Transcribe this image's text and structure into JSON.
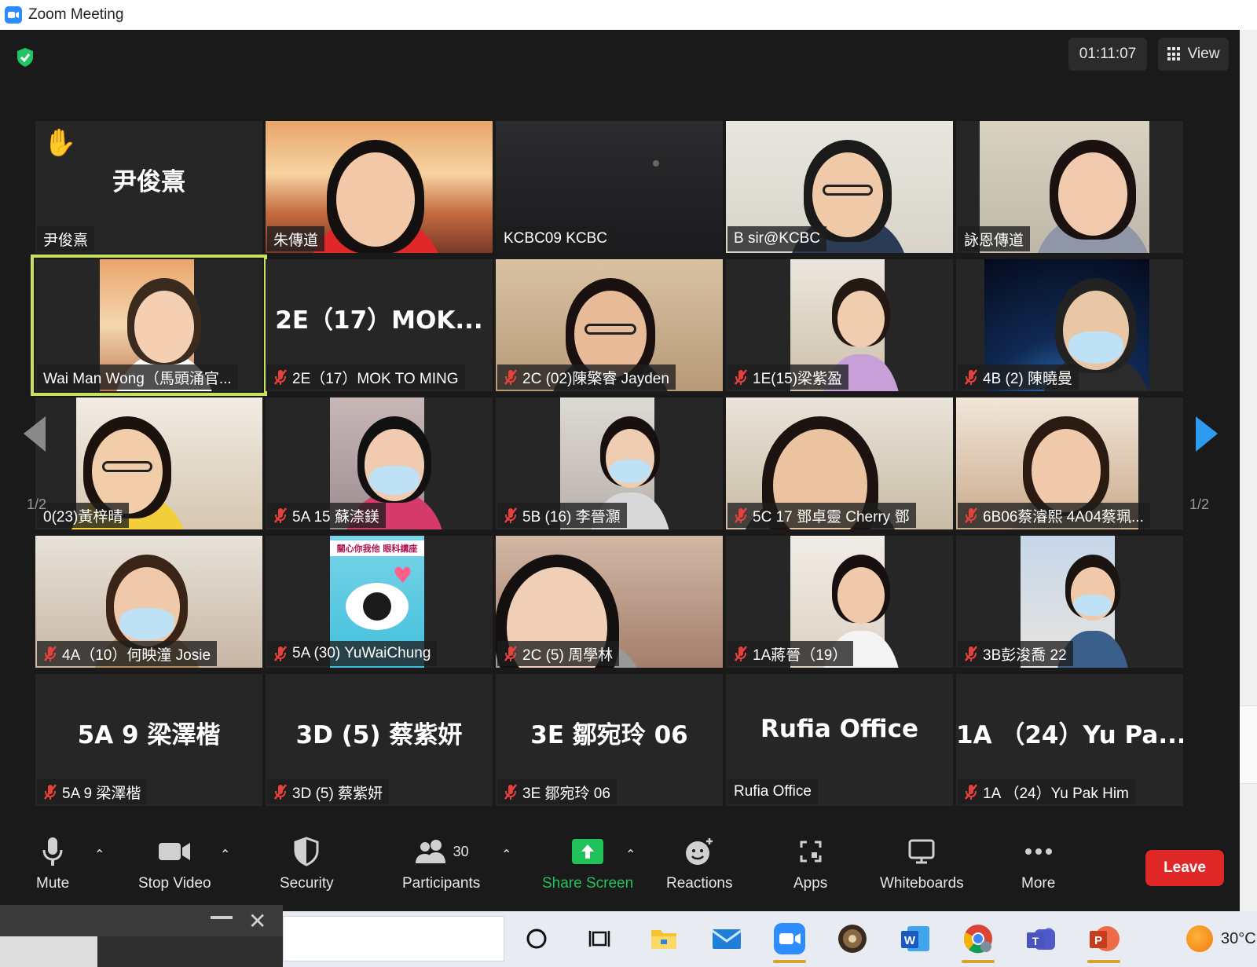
{
  "window": {
    "title": "Zoom Meeting"
  },
  "header": {
    "timer": "01:11:07",
    "view_label": "View"
  },
  "gallery": {
    "page_indicator": "1/2",
    "tiles": [
      {
        "big_name": "尹俊熹",
        "label": "尹俊熹",
        "muted": false,
        "hand_raised": true
      },
      {
        "big_name": "",
        "label": "朱傳道",
        "muted": false
      },
      {
        "big_name": "",
        "label": "KCBC09 KCBC",
        "muted": false
      },
      {
        "big_name": "",
        "label": "B sir@KCBC",
        "muted": false
      },
      {
        "big_name": "",
        "label": "詠恩傳道",
        "muted": false
      },
      {
        "big_name": "",
        "label": "Wai Man Wong（馬頭涌官...",
        "muted": false,
        "active_speaker": true
      },
      {
        "big_name": "2E（17）MOK...",
        "label": "2E（17）MOK TO MING",
        "muted": true
      },
      {
        "big_name": "",
        "label": "2C (02)陳檠睿 Jayden",
        "muted": true
      },
      {
        "big_name": "",
        "label": "1E(15)梁紫盈",
        "muted": true
      },
      {
        "big_name": "",
        "label": "4B (2) 陳曉曼",
        "muted": true
      },
      {
        "big_name": "",
        "label": "0(23)黃梓晴",
        "muted": false
      },
      {
        "big_name": "",
        "label": "5A 15 蘇渿鎂",
        "muted": true
      },
      {
        "big_name": "",
        "label": "5B (16) 李晉灝",
        "muted": true
      },
      {
        "big_name": "",
        "label": "5C 17 鄧卓靈 Cherry 鄧",
        "muted": true
      },
      {
        "big_name": "",
        "label": "6B06蔡濬熙 4A04蔡珮...",
        "muted": true
      },
      {
        "big_name": "",
        "label": "4A（10）何映潼 Josie",
        "muted": true
      },
      {
        "big_name": "",
        "label": "5A (30) YuWaiChung",
        "muted": true
      },
      {
        "big_name": "",
        "label": "2C (5) 周學林",
        "muted": true
      },
      {
        "big_name": "",
        "label": "1A蔣晉（19）",
        "muted": true
      },
      {
        "big_name": "",
        "label": "3B彭浚喬 22",
        "muted": true
      },
      {
        "big_name": "5A 9 梁澤楷",
        "label": "5A 9 梁澤楷",
        "muted": true
      },
      {
        "big_name": "3D (5) 蔡紫妍",
        "label": "3D (5) 蔡紫妍",
        "muted": true
      },
      {
        "big_name": "3E 鄒宛玲 06",
        "label": "3E 鄒宛玲 06",
        "muted": true
      },
      {
        "big_name": "Rufia Office",
        "label": "Rufia Office",
        "muted": false
      },
      {
        "big_name": "1A （24）Yu Pa...",
        "label": "1A （24）Yu Pak Him",
        "muted": true
      }
    ],
    "slide_text": "關心你我他 眼科講座"
  },
  "toolbar": {
    "mute": "Mute",
    "stop_video": "Stop Video",
    "security": "Security",
    "participants": "Participants",
    "participant_count": "30",
    "share_screen": "Share Screen",
    "reactions": "Reactions",
    "apps": "Apps",
    "whiteboards": "Whiteboards",
    "more": "More",
    "leave": "Leave"
  },
  "taskbar": {
    "temperature": "30°C"
  },
  "colors": {
    "accent_share": "#22c25a",
    "leave": "#e02828",
    "active_border": "#c7e25f",
    "muted_icon": "#e8413c"
  }
}
